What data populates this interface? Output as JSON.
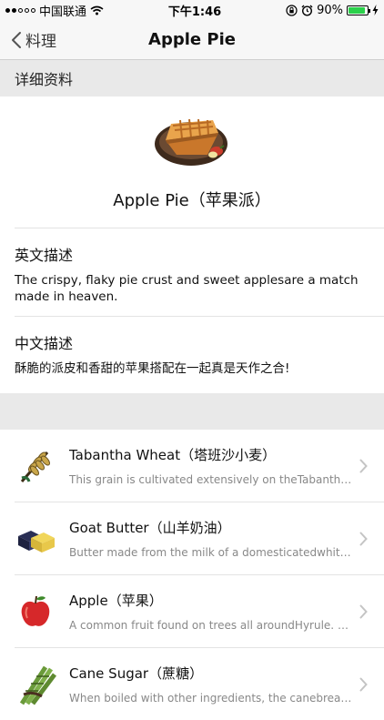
{
  "status_bar": {
    "carrier": "中国联通",
    "time": "下午1:46",
    "battery_pct": "90%",
    "battery_fraction": 0.9,
    "battery_color": "#2bd14b",
    "signal_bars": 2
  },
  "nav": {
    "back_label": "料理",
    "title": "Apple Pie"
  },
  "details": {
    "section_title": "详细资料",
    "dish_name": "Apple Pie（苹果派）",
    "en_heading": "英文描述",
    "en_text": "The crispy, flaky pie crust and sweet applesare a match made in heaven.",
    "cn_heading": "中文描述",
    "cn_text": "酥脆的派皮和香甜的苹果搭配在一起真是天作之合!"
  },
  "ingredients": [
    {
      "name": "Tabantha Wheat（塔班沙小麦）",
      "desc": "This grain is cultivated extensively on theTabantha Frontier...",
      "icon": "wheat-icon"
    },
    {
      "name": "Goat Butter（山羊奶油）",
      "desc": "Butter made from the milk of a domesticatedwhite goat...",
      "icon": "butter-icon"
    },
    {
      "name": "Apple（苹果）",
      "desc": "A common fruit found on trees all aroundHyrule. Eat it fresh...",
      "icon": "apple-icon"
    },
    {
      "name": "Cane Sugar（蔗糖）",
      "desc": "When boiled with other ingredients, the canebreak...",
      "icon": "cane-sugar-icon"
    }
  ]
}
